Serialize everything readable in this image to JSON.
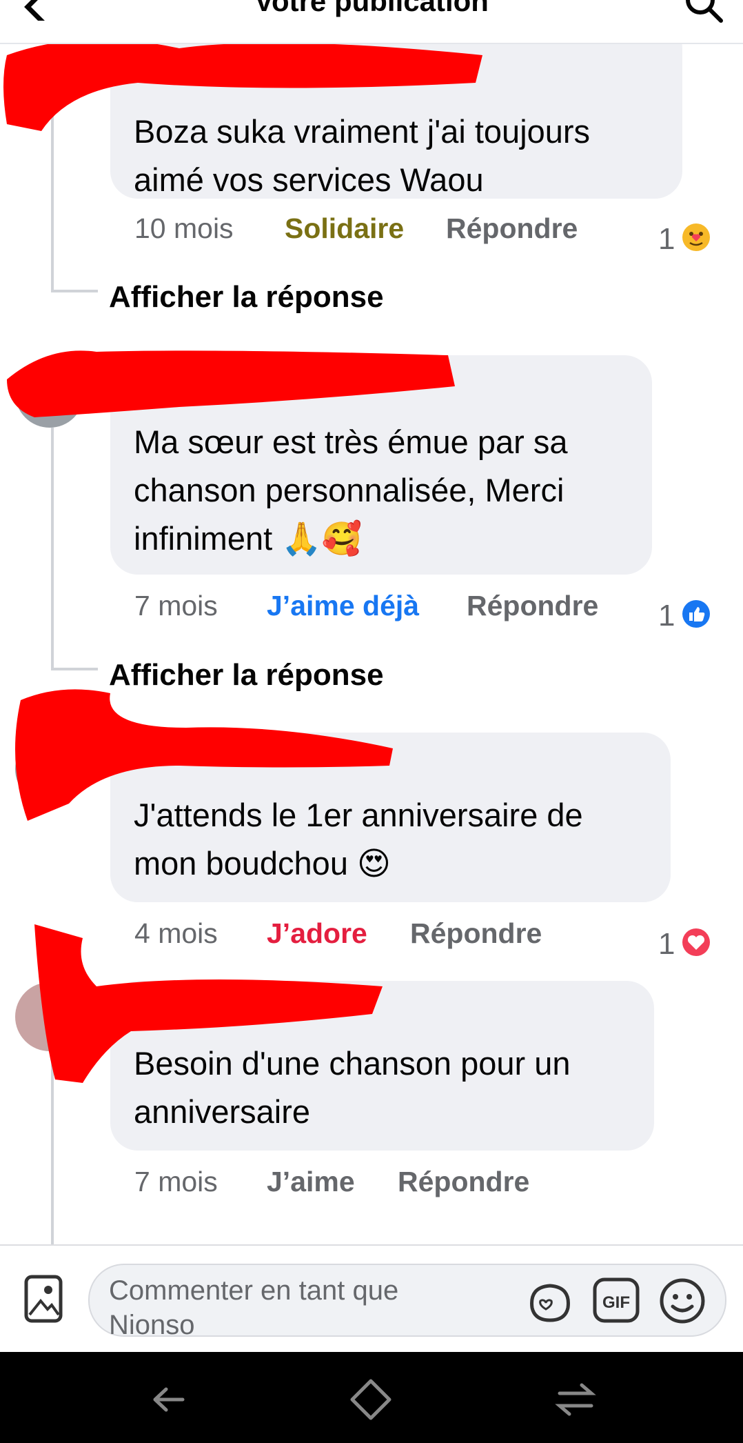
{
  "header": {
    "title": "Votre publication"
  },
  "comments": [
    {
      "text": "Boza suka vraiment j'ai toujours aimé vos services Waou",
      "line1": "Boza suka vraiment j'ai toujours",
      "line2": "aimé vos services Waou",
      "time": "10 mois",
      "reaction_label": "Solidaire",
      "reaction_color": "#7a7014",
      "reply_label": "Répondre",
      "count": "1",
      "reaction_icon": "care-emoji"
    },
    {
      "line1": "Ma sœur est très émue par sa",
      "line2": "chanson personnalisée, Merci",
      "line3": "infiniment 🙏🥰",
      "time": "7 mois",
      "reaction_label": "J’aime déjà",
      "reaction_color": "#1877f2",
      "reply_label": "Répondre",
      "count": "1",
      "reaction_icon": "like-icon"
    },
    {
      "line1": "J'attends le 1er anniversaire de",
      "line2": "mon boudchou 😍",
      "time": "4 mois",
      "reaction_label": "J’adore",
      "reaction_color": "#e41e3f",
      "reply_label": "Répondre",
      "count": "1",
      "reaction_icon": "love-icon"
    },
    {
      "line1": "Besoin d'une chanson pour un",
      "line2": "anniversaire",
      "time": "7 mois",
      "reaction_label": "J’aime",
      "reaction_color": "#65676b",
      "reply_label": "Répondre"
    }
  ],
  "show_reply_label": "Afficher la réponse",
  "composer": {
    "placeholder_line1": "Commenter en tant que",
    "placeholder_line2": "Nionso"
  }
}
